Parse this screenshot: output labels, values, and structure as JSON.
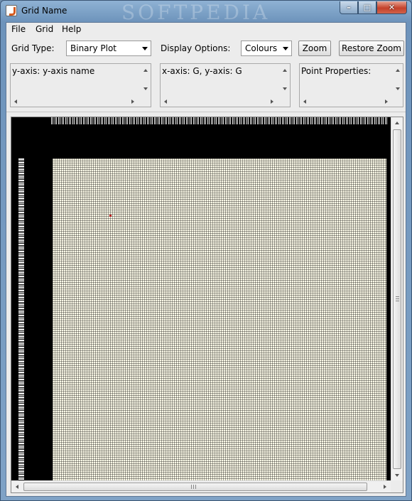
{
  "window": {
    "title": "Grid Name",
    "watermark": "SOFTPEDIA"
  },
  "menu": [
    "File",
    "Grid",
    "Help"
  ],
  "toolbar": {
    "grid_type_label": "Grid Type:",
    "grid_type_value": "Binary Plot",
    "display_options_label": "Display Options:",
    "display_options_value": "Colours",
    "zoom_label": "Zoom",
    "restore_zoom_label": "Restore Zoom"
  },
  "info_boxes": {
    "y_axis": "y-axis: y-axis name",
    "x_axis": "x-axis: G, y-axis: G",
    "point_properties": "Point Properties:"
  },
  "colors": {
    "grid_background": "#fdfbe9",
    "plot_black": "#000000",
    "marker": "#b22222"
  }
}
